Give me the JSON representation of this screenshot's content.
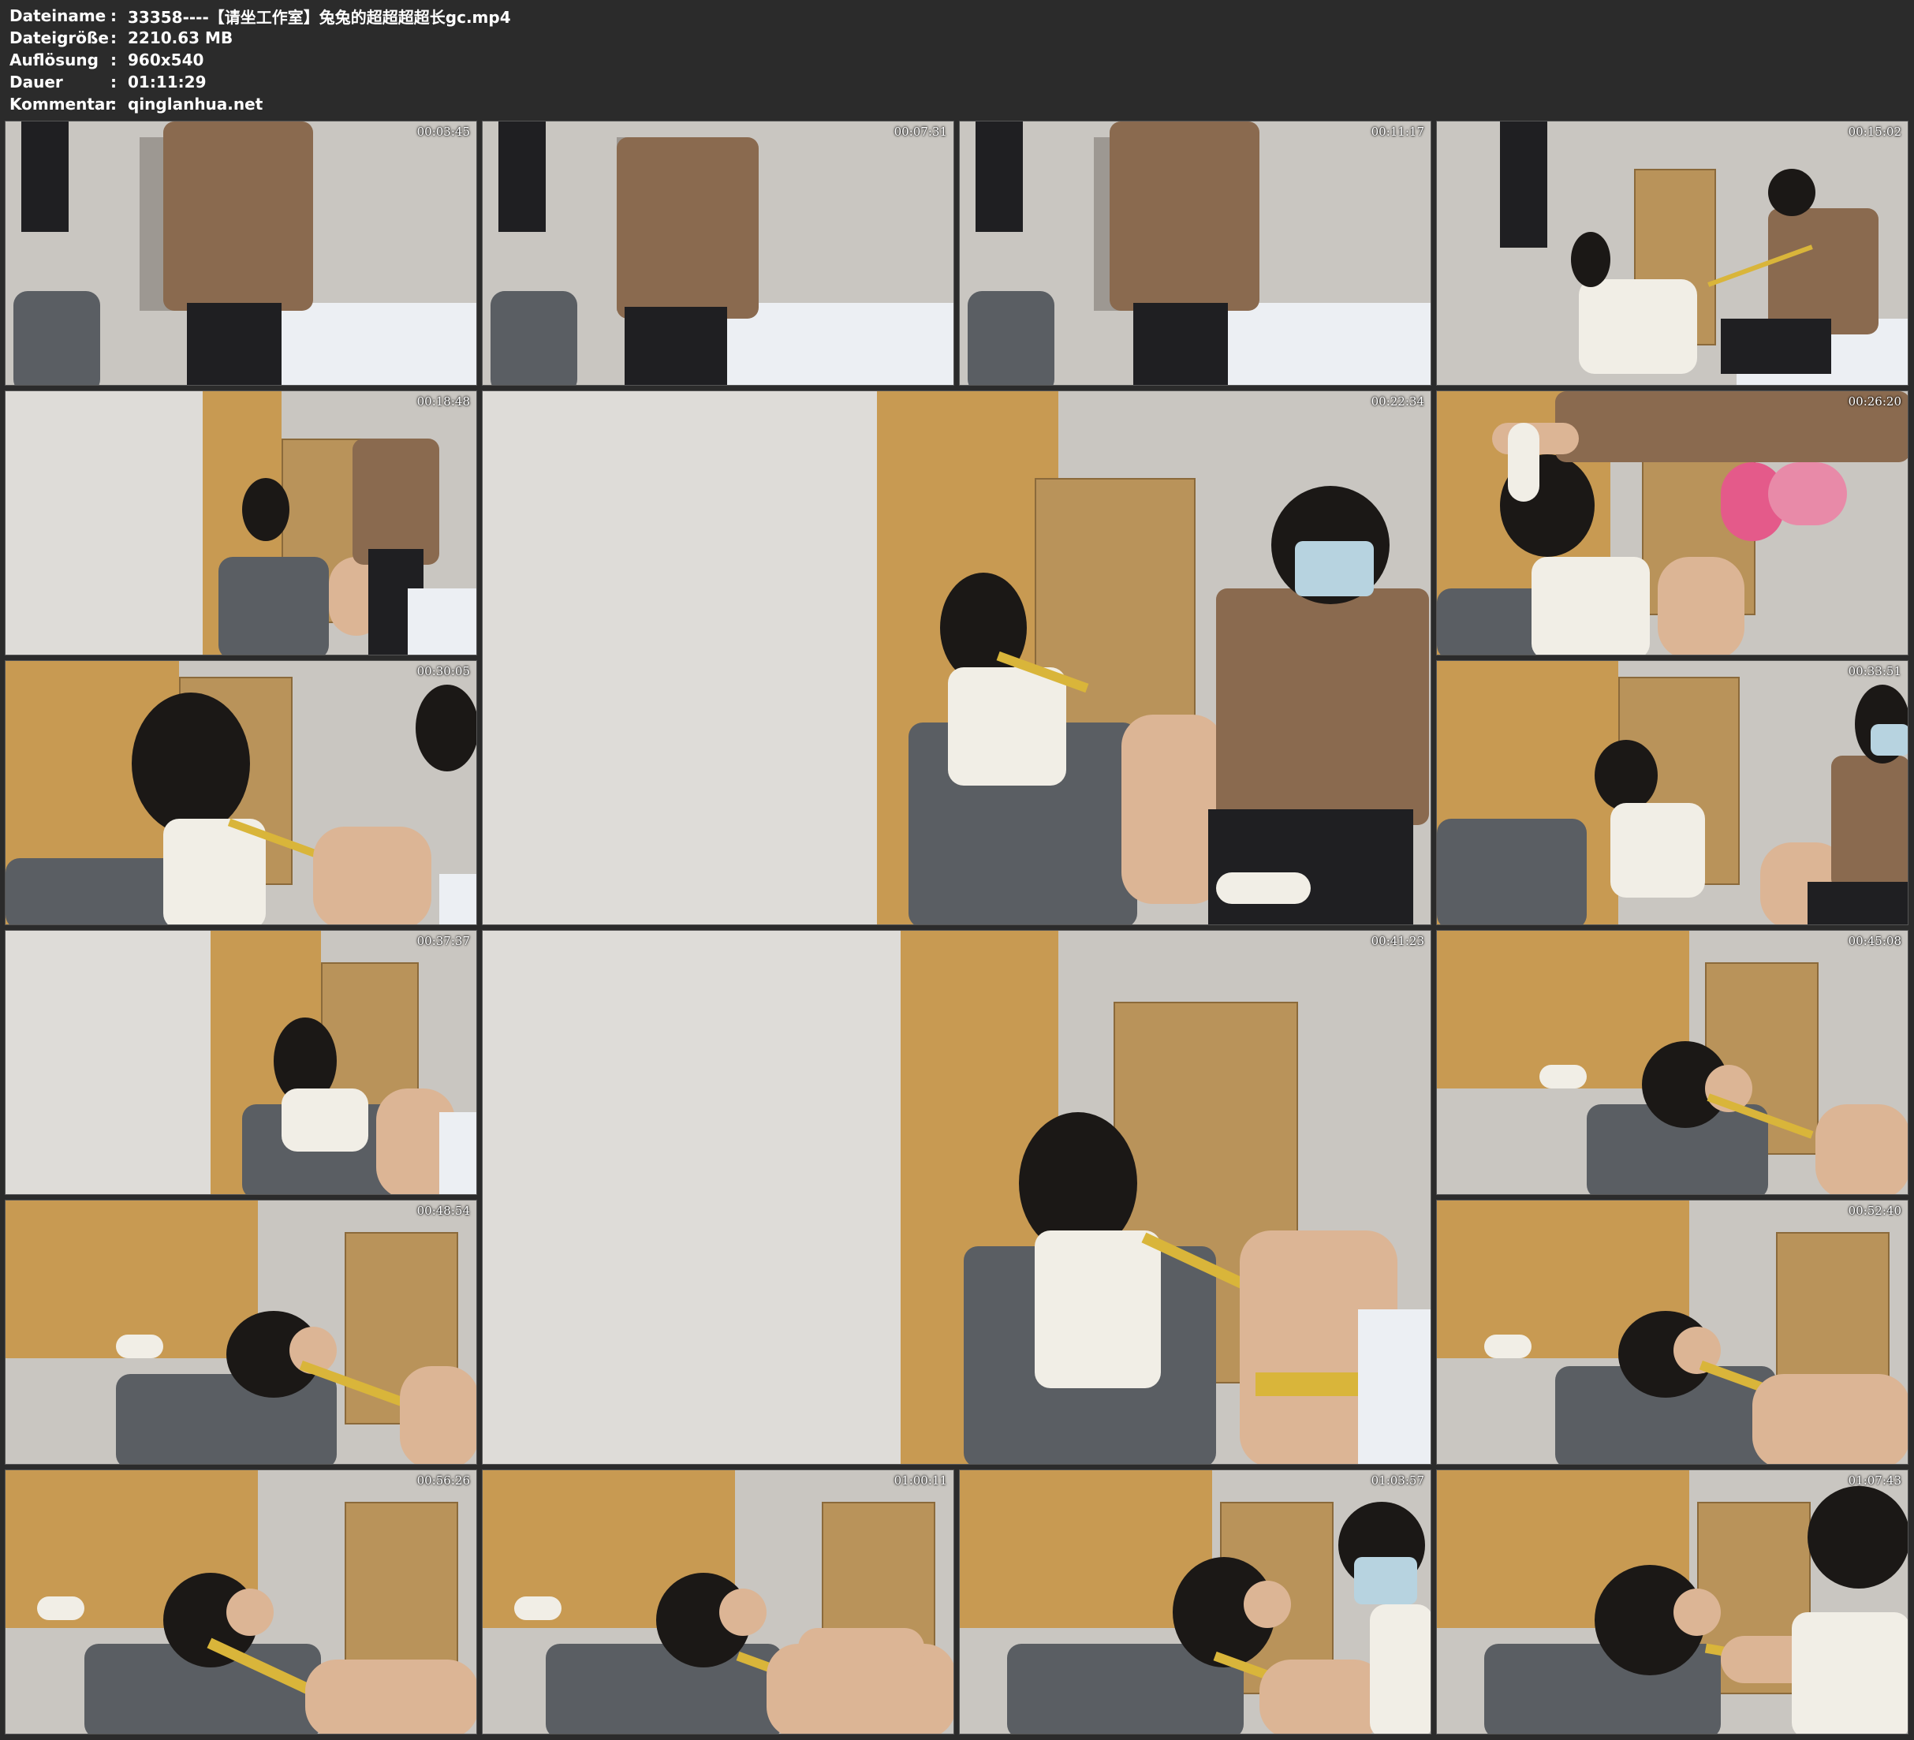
{
  "meta": [
    {
      "label": "Dateiname",
      "value": "33358----【请坐工作室】兔兔的超超超超长gc.mp4"
    },
    {
      "label": "Dateigröße",
      "value": "2210.63 MB"
    },
    {
      "label": "Auflösung",
      "value": "960x540"
    },
    {
      "label": "Dauer",
      "value": "01:11:29"
    },
    {
      "label": "Kommentar",
      "value": "qinglanhua.net"
    }
  ],
  "thumbnails": [
    {
      "timestamp": "00:03:45",
      "scene": "hotel-room-man-standing"
    },
    {
      "timestamp": "00:07:31",
      "scene": "hotel-room-man-leaning"
    },
    {
      "timestamp": "00:11:17",
      "scene": "hotel-room-man-standing"
    },
    {
      "timestamp": "00:15:02",
      "scene": "man-with-rope-on-bed"
    },
    {
      "timestamp": "00:18:48",
      "scene": "man-at-door"
    },
    {
      "timestamp": "00:22:34",
      "scene": "large-man-with-device"
    },
    {
      "timestamp": "00:26:20",
      "scene": "closeup-hands-with-device"
    },
    {
      "timestamp": "00:30:05",
      "scene": "woman-on-chair-man-close"
    },
    {
      "timestamp": "00:33:51",
      "scene": "woman-on-chair-man-side"
    },
    {
      "timestamp": "00:37:37",
      "scene": "woman-on-chair"
    },
    {
      "timestamp": "00:41:23",
      "scene": "large-woman-on-chair"
    },
    {
      "timestamp": "00:45:08",
      "scene": "woman-reclined"
    },
    {
      "timestamp": "00:48:54",
      "scene": "woman-reclined"
    },
    {
      "timestamp": "00:52:40",
      "scene": "woman-reclined"
    },
    {
      "timestamp": "00:56:26",
      "scene": "woman-reclined"
    },
    {
      "timestamp": "01:00:11",
      "scene": "woman-reclined-hand"
    },
    {
      "timestamp": "01:03:57",
      "scene": "woman-reclined-man"
    },
    {
      "timestamp": "01:07:43",
      "scene": "woman-reclined-man-close"
    }
  ]
}
